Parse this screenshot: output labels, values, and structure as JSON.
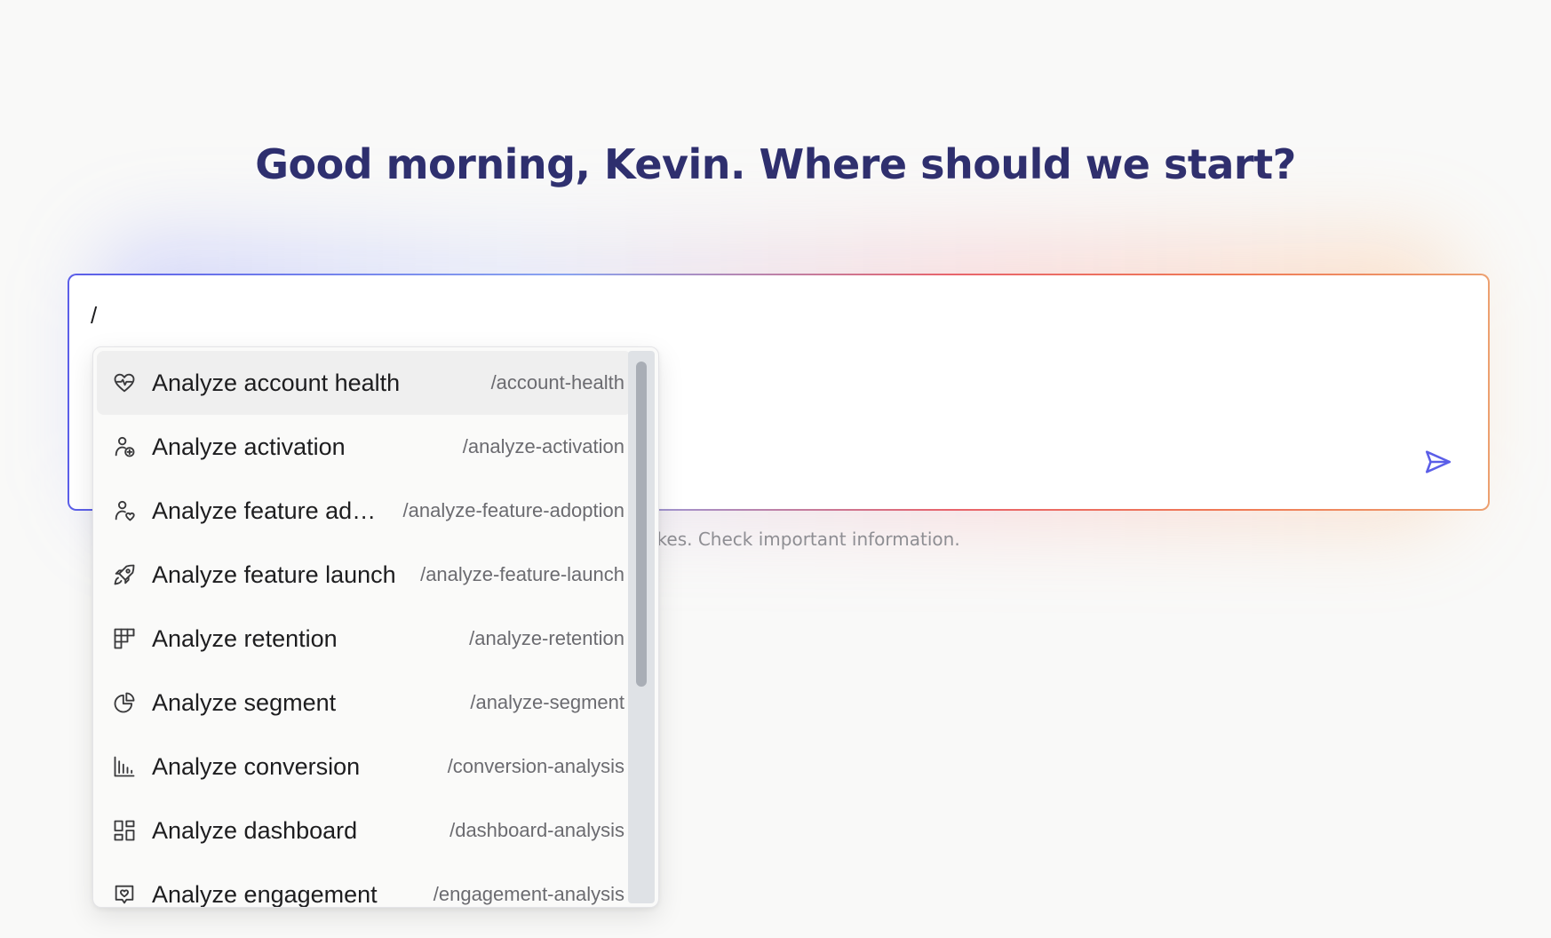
{
  "greeting": "Good morning, Kevin. Where should we start?",
  "composer": {
    "value": "/",
    "send_icon": "send-icon"
  },
  "disclaimer": "e mistakes. Check important information.",
  "commands": [
    {
      "label": "Analyze account health",
      "slug": "/account-health",
      "icon": "heart-pulse-icon",
      "active": true
    },
    {
      "label": "Analyze activation",
      "slug": "/analyze-activation",
      "icon": "user-plus-icon"
    },
    {
      "label": "Analyze feature adoption",
      "slug": "/analyze-feature-adoption",
      "icon": "user-heart-icon"
    },
    {
      "label": "Analyze feature launch",
      "slug": "/analyze-feature-launch",
      "icon": "rocket-icon"
    },
    {
      "label": "Analyze retention",
      "slug": "/analyze-retention",
      "icon": "retention-grid-icon"
    },
    {
      "label": "Analyze segment",
      "slug": "/analyze-segment",
      "icon": "pie-chart-icon"
    },
    {
      "label": "Analyze conversion",
      "slug": "/conversion-analysis",
      "icon": "bar-chart-icon"
    },
    {
      "label": "Analyze dashboard",
      "slug": "/dashboard-analysis",
      "icon": "dashboard-icon"
    },
    {
      "label": "Analyze engagement",
      "slug": "/engagement-analysis",
      "icon": "heart-message-icon"
    }
  ]
}
